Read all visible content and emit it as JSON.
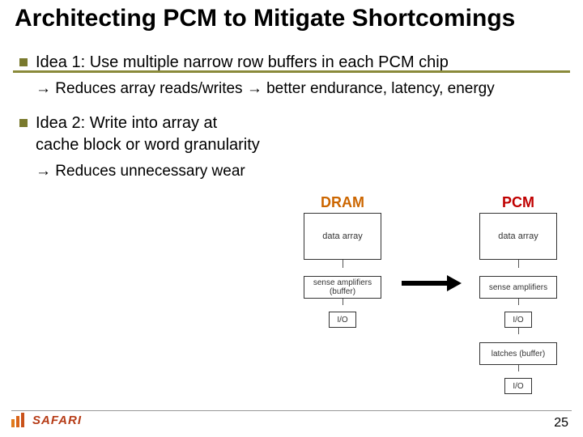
{
  "title": "Architecting PCM to Mitigate Shortcomings",
  "bullets": [
    {
      "text": "Idea 1: Use multiple narrow row buffers in each PCM chip",
      "sub": "→ Reduces array reads/writes → better endurance, latency, energy"
    },
    {
      "text": "Idea 2: Write into array at cache block or word granularity",
      "sub": "→ Reduces unnecessary wear"
    }
  ],
  "diagram": {
    "dram": {
      "title": "DRAM",
      "data_array": "data array",
      "sense": "sense amplifiers (buffer)",
      "io": "I/O"
    },
    "pcm": {
      "title": "PCM",
      "data_array": "data array",
      "sense": "sense amplifiers",
      "latches": "latches (buffer)",
      "io1": "I/O",
      "io2": "I/O"
    }
  },
  "logo_text": "SAFARI",
  "page_number": "25"
}
